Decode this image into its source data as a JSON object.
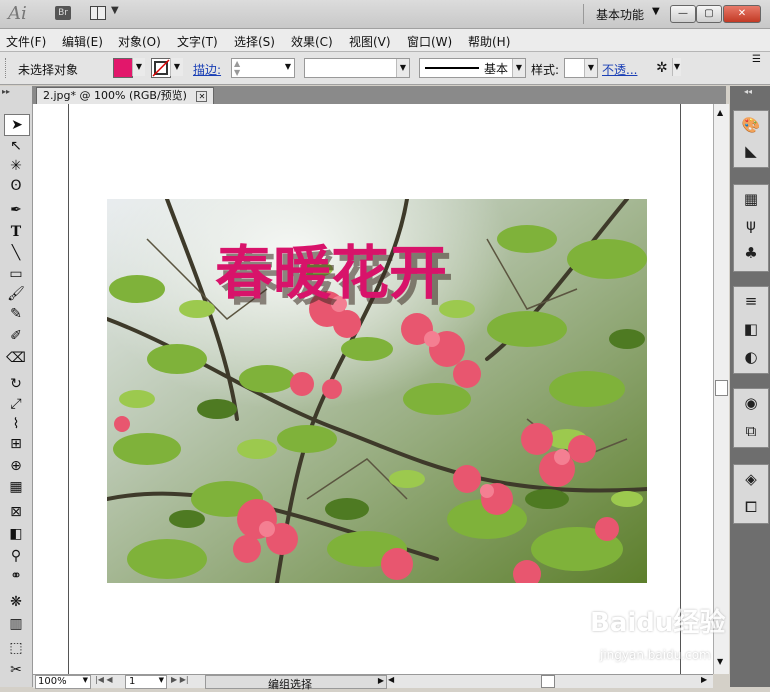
{
  "titlebar": {
    "app_logo": "Ai",
    "bridge_label": "Br",
    "workspace": "基本功能",
    "window_buttons": [
      "—",
      "▢",
      "✕"
    ]
  },
  "menubar": {
    "items": [
      "文件(F)",
      "编辑(E)",
      "对象(O)",
      "文字(T)",
      "选择(S)",
      "效果(C)",
      "视图(V)",
      "窗口(W)",
      "帮助(H)"
    ]
  },
  "control_bar": {
    "selection_status": "未选择对象",
    "fill_color": "#e2176b",
    "stroke_label": "描边:",
    "stroke_profile": "基本",
    "style_label": "样式:",
    "opacity_link": "不透..."
  },
  "document": {
    "tab_title": "2.jpg* @ 100% (RGB/预览)"
  },
  "status_bar": {
    "zoom": "100%",
    "page": "1",
    "status_text": "编组选择"
  },
  "artwork": {
    "title_text": "春暖花开",
    "title_color": "#d8136a"
  },
  "watermark": {
    "line1": "Baidu经验",
    "line2": "jingyan.baidu.com"
  }
}
